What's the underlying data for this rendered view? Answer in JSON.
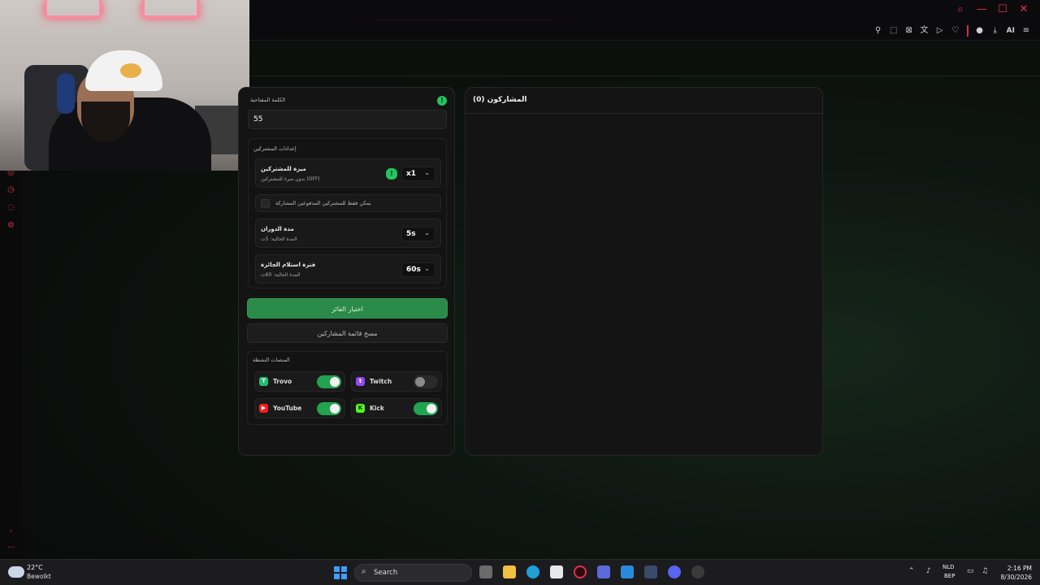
{
  "window": {
    "controls": [
      "search-icon",
      "minimize-icon",
      "maximize-icon",
      "close-icon"
    ],
    "toolbar_ai_label": "AI"
  },
  "left_panel": {
    "keyword_label": "الكلمة المفتاحية",
    "keyword_value": "55",
    "subscriber_settings_title": "إعدادات المشتركين",
    "subscriber_perk": {
      "name": "ميزة للمشتركين",
      "desc": "بدون ميزة للمشتركين (OFF)",
      "value": "x1"
    },
    "subs_only_checkbox_label": "يمكن فقط للمشتركين المدفوعين المشاركة",
    "spin_duration": {
      "name": "مدة الدوران",
      "desc": "المدة الحالية: 5ث",
      "value": "5s"
    },
    "claim_period": {
      "name": "فترة استلام الجائزة",
      "desc": "المدة الحالية: 60ث",
      "value": "60s"
    },
    "pick_winner_button": "اختيار الفائز",
    "clear_list_button": "مسح قائمة المشاركين",
    "platforms_title": "المنصات النشطة",
    "platforms": [
      {
        "name": "Trovo",
        "enabled": true,
        "color": "#20c070"
      },
      {
        "name": "Twitch",
        "enabled": false,
        "color": "#9146ff"
      },
      {
        "name": "YouTube",
        "enabled": true,
        "color": "#ff1a1a"
      },
      {
        "name": "Kick",
        "enabled": true,
        "color": "#53fc18"
      }
    ]
  },
  "right_panel": {
    "participants_title": "المشاركون (0)"
  },
  "colors": {
    "accent_green": "#22c55e",
    "button_green": "#2a8a48",
    "accent_red": "#e0304a"
  },
  "taskbar": {
    "weather_temp": "22°C",
    "weather_desc": "Bewolkt",
    "search_placeholder": "Search",
    "lang_top": "NLD",
    "lang_bottom": "BEP",
    "time": "2:16 PM",
    "date": "8/30/2026"
  }
}
